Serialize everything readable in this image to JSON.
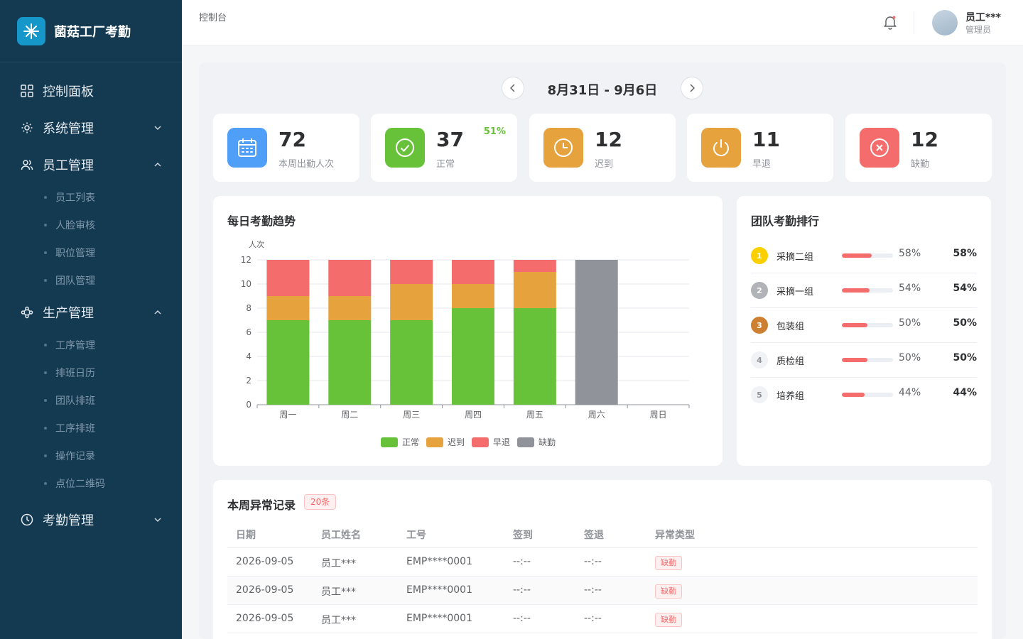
{
  "app": {
    "title": "菌菇工厂考勤"
  },
  "sidebar": {
    "items": [
      {
        "label": "控制面板",
        "icon": "dashboard-icon"
      },
      {
        "label": "系统管理",
        "icon": "gear-icon",
        "expanded": false
      },
      {
        "label": "员工管理",
        "icon": "users-icon",
        "expanded": true,
        "children": [
          "员工列表",
          "人脸审核",
          "职位管理",
          "团队管理"
        ]
      },
      {
        "label": "生产管理",
        "icon": "network-icon",
        "expanded": true,
        "children": [
          "工序管理",
          "排班日历",
          "团队排班",
          "工序排班",
          "操作记录",
          "点位二维码"
        ]
      },
      {
        "label": "考勤管理",
        "icon": "clock-icon",
        "expanded": false
      }
    ]
  },
  "header": {
    "breadcrumb": "控制台",
    "user_name": "员工***",
    "user_role": "管理员"
  },
  "week": {
    "range": "8月31日 - 9月6日"
  },
  "stats": [
    {
      "value": "72",
      "label": "本周出勤人次",
      "color": "#4f9ef8",
      "icon": "calendar-icon"
    },
    {
      "value": "37",
      "label": "正常",
      "pct": "51%",
      "color": "#67c23a",
      "icon": "check-circle-icon"
    },
    {
      "value": "12",
      "label": "迟到",
      "color": "#e6a23c",
      "icon": "clock-icon"
    },
    {
      "value": "11",
      "label": "早退",
      "color": "#e6a23c",
      "icon": "power-icon"
    },
    {
      "value": "12",
      "label": "缺勤",
      "color": "#f56c6c",
      "icon": "x-circle-icon"
    }
  ],
  "trend": {
    "title": "每日考勤趋势",
    "legend": [
      "正常",
      "迟到",
      "早退",
      "缺勤"
    ]
  },
  "chart_data": {
    "type": "bar",
    "stacked": true,
    "title": "每日考勤趋势",
    "ylabel": "人次",
    "xlabel": "",
    "ylim": [
      0,
      12
    ],
    "yticks": [
      0,
      2,
      4,
      6,
      8,
      10,
      12
    ],
    "categories": [
      "周一",
      "周二",
      "周三",
      "周四",
      "周五",
      "周六",
      "周日"
    ],
    "series": [
      {
        "name": "正常",
        "color": "#67c23a",
        "values": [
          7,
          7,
          7,
          8,
          8,
          0,
          0
        ]
      },
      {
        "name": "迟到",
        "color": "#e6a23c",
        "values": [
          2,
          2,
          3,
          2,
          3,
          0,
          0
        ]
      },
      {
        "name": "早退",
        "color": "#f56c6c",
        "values": [
          3,
          3,
          2,
          2,
          1,
          0,
          0
        ]
      },
      {
        "name": "缺勤",
        "color": "#909399",
        "values": [
          0,
          0,
          0,
          0,
          0,
          12,
          0
        ]
      }
    ],
    "legend_position": "bottom",
    "grid": true
  },
  "ranking": {
    "title": "团队考勤排行",
    "items": [
      {
        "rank": "1",
        "name": "采摘二组",
        "pct": "58%",
        "value": 58,
        "badge_color": "#fccf00"
      },
      {
        "rank": "2",
        "name": "采摘一组",
        "pct": "54%",
        "value": 54,
        "badge_color": "#b0b3b8"
      },
      {
        "rank": "3",
        "name": "包装组",
        "pct": "50%",
        "value": 50,
        "badge_color": "#cd7f32"
      },
      {
        "rank": "4",
        "name": "质检组",
        "pct": "50%",
        "value": 50,
        "badge_color": "#f0f2f5"
      },
      {
        "rank": "5",
        "name": "培养组",
        "pct": "44%",
        "value": 44,
        "badge_color": "#f0f2f5"
      }
    ]
  },
  "anomalies": {
    "title": "本周异常记录",
    "count": "20条",
    "columns": [
      "日期",
      "员工姓名",
      "工号",
      "签到",
      "签退",
      "异常类型"
    ],
    "rows": [
      [
        "2026-09-05",
        "员工***",
        "EMP****0001",
        "--:--",
        "--:--",
        "缺勤"
      ],
      [
        "2026-09-05",
        "员工***",
        "EMP****0001",
        "--:--",
        "--:--",
        "缺勤"
      ],
      [
        "2026-09-05",
        "员工***",
        "EMP****0001",
        "--:--",
        "--:--",
        "缺勤"
      ]
    ]
  }
}
